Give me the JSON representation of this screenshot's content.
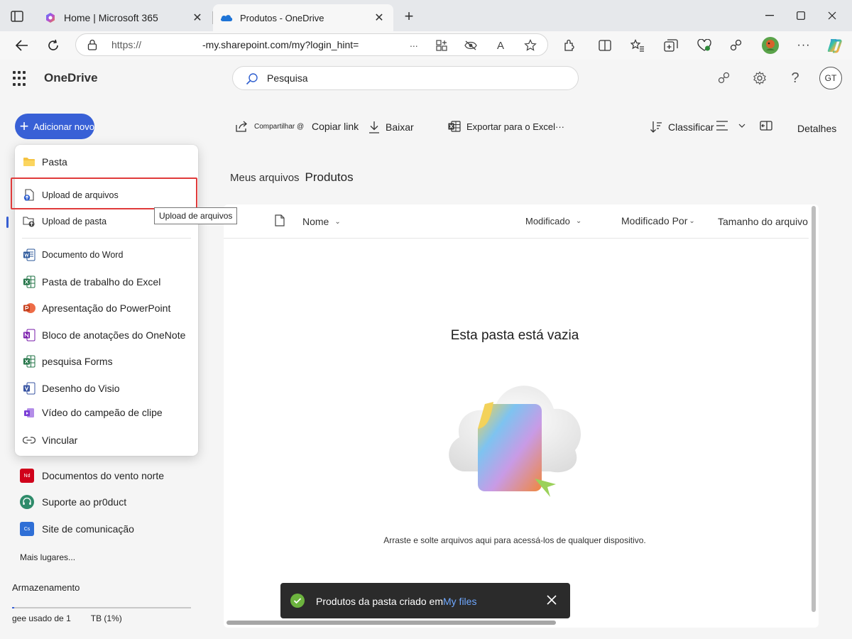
{
  "browser": {
    "tabs": [
      {
        "title": "Home | Microsoft 365",
        "active": false
      },
      {
        "title": "Produtos - OneDrive",
        "active": true
      }
    ],
    "url_prefix": "https://",
    "url_main": "-my.sharepoint.com/my?login_hint=",
    "url_ellipsis": "...",
    "reader_label": "A"
  },
  "app": {
    "name": "OneDrive",
    "search_placeholder": "Pesquisa",
    "avatar_initials": "GT",
    "add_new_label": "Adicionar novo"
  },
  "commandbar": {
    "share": "Compartilhar @",
    "copy_link": "Copiar link",
    "download": "Baixar",
    "export_excel": "Exportar para o Excel",
    "more": "···",
    "sort": "Classificar",
    "details": "Detalhes"
  },
  "breadcrumb": {
    "root": "Meus arquivos",
    "current": "Produtos"
  },
  "list": {
    "columns": [
      "Nome",
      "Modificado",
      "Modificado Por",
      "Tamanho do arquivo"
    ],
    "empty_title": "Esta pasta está vazia",
    "empty_subtitle": "Arraste e solte arquivos aqui para acessá-los de qualquer dispositivo."
  },
  "menu": {
    "items": [
      {
        "label": "Pasta",
        "icon": "folder-icon"
      },
      {
        "label": "Upload de arquivos",
        "icon": "file-upload-icon"
      },
      {
        "label": "Upload de pasta",
        "icon": "folder-upload-icon"
      },
      {
        "label": "Documento do Word",
        "icon": "word-icon"
      },
      {
        "label": "Pasta de trabalho do Excel",
        "icon": "excel-icon"
      },
      {
        "label": "Apresentação do PowerPoint",
        "icon": "powerpoint-icon"
      },
      {
        "label": "Bloco de anotações do OneNote",
        "icon": "onenote-icon"
      },
      {
        "label": "pesquisa Forms",
        "icon": "forms-icon"
      },
      {
        "label": "Desenho do Visio",
        "icon": "visio-icon"
      },
      {
        "label": "Vídeo do campeão de clipe",
        "icon": "clipchamp-icon"
      },
      {
        "label": "Vincular",
        "icon": "link-icon"
      }
    ],
    "tooltip": "Upload de arquivos"
  },
  "leftnav": {
    "places": [
      {
        "label": "Documentos do vento norte",
        "badge": "Nd",
        "color": "#d0021b"
      },
      {
        "label": "Suporte ao pr0duct",
        "badge": "",
        "color": "#2e8b6a"
      },
      {
        "label": "Site de comunicação",
        "badge": "Cs",
        "color": "#2f6fd6"
      }
    ],
    "more_places": "Mais lugares...",
    "storage_title": "Armazenamento",
    "storage_used": "gee usado de 1",
    "storage_total": "TB (1%)",
    "storage_percent": 1
  },
  "toast": {
    "message": "Produtos da pasta criado em",
    "link": "My files"
  },
  "colors": {
    "accent": "#3860d6",
    "highlight": "#e03b3b",
    "toast_bg": "#2b2b2b",
    "success": "#6cb33e"
  }
}
